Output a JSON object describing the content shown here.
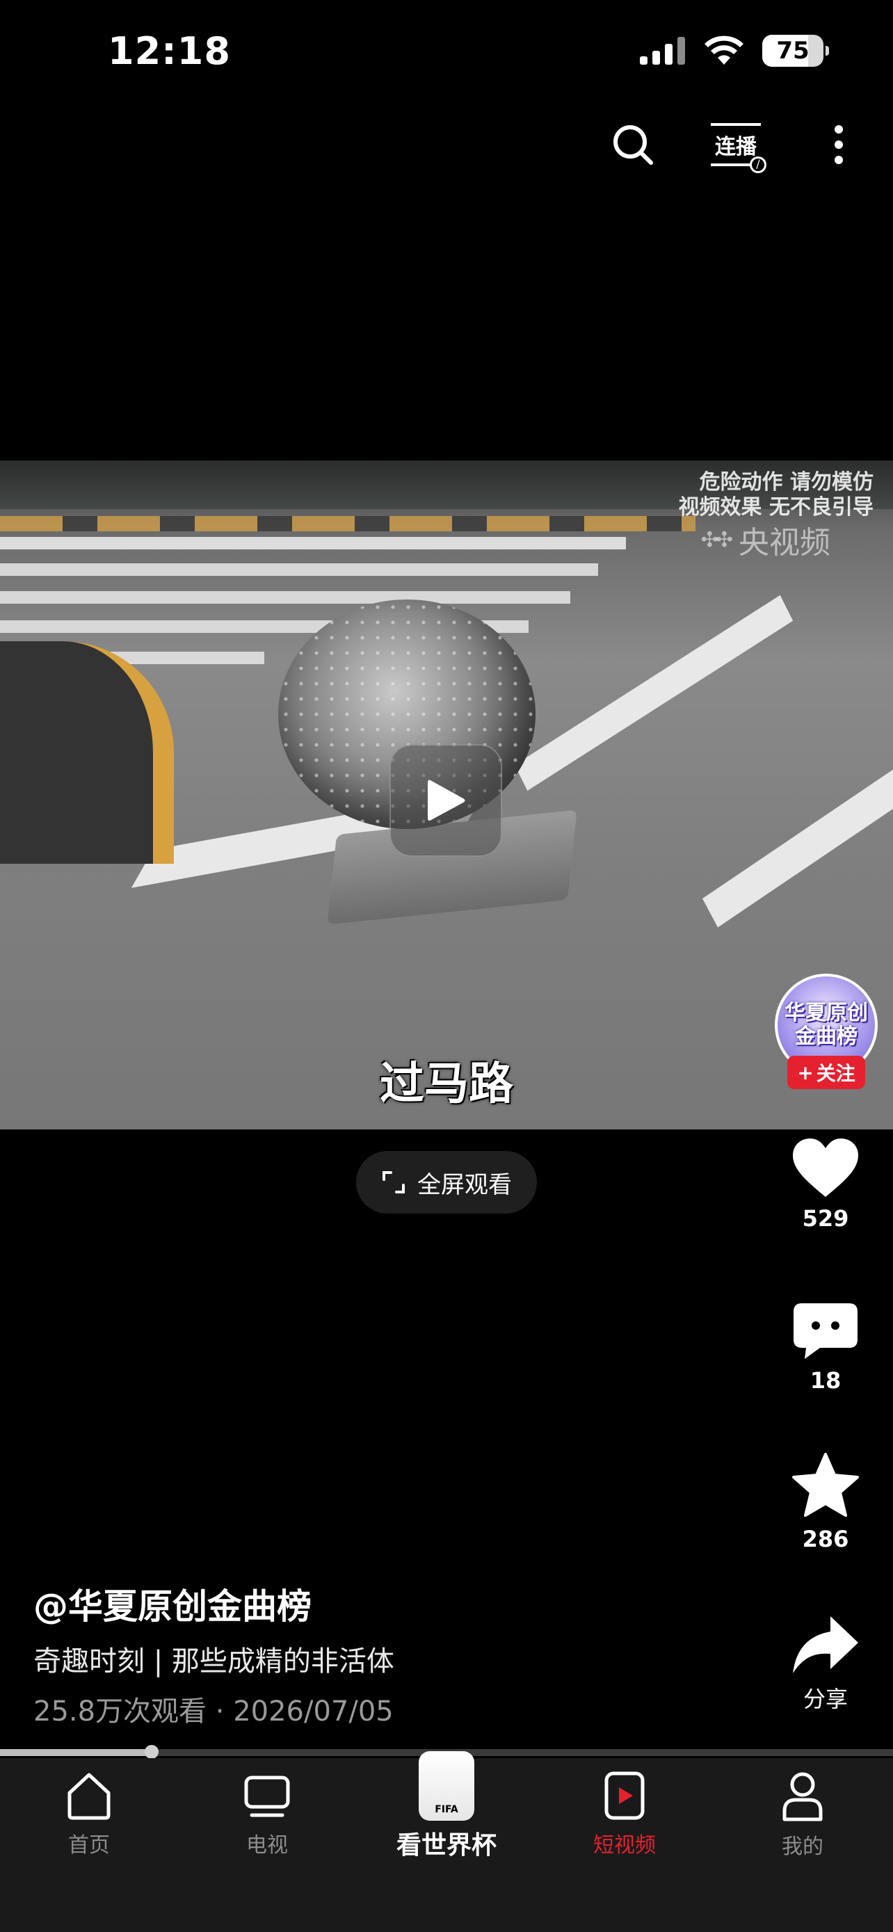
{
  "status_bar": {
    "time": "12:18",
    "battery": "75",
    "battery_level": 0.75
  },
  "top_bar": {
    "search_icon": "search-icon",
    "cast_label": "连播",
    "more_icon": "more-vertical-icon"
  },
  "video": {
    "watermark_line1": "危险动作 请勿模仿",
    "watermark_line2": "视频效果 无不良引导",
    "brand_watermark": "央视频",
    "caption": "过马路",
    "play_icon": "play-icon"
  },
  "fullscreen_label": "全屏观看",
  "author_avatar": {
    "text_line1": "华夏原创",
    "text_line2": "金曲榜",
    "follow_label": "关注"
  },
  "actions": {
    "like_count": "529",
    "comment_count": "18",
    "favorite_count": "286",
    "share_label": "分享"
  },
  "post": {
    "author": "@华夏原创金曲榜",
    "description": "奇趣时刻 | 那些成精的非活体",
    "meta": "25.8万次观看 · 2026/07/05"
  },
  "progress": 0.17,
  "tabs": [
    {
      "label": "首页",
      "icon": "home-icon"
    },
    {
      "label": "电视",
      "icon": "tv-icon"
    },
    {
      "label": "看世界杯",
      "icon": "world-cup-trophy-icon",
      "trophy_text": "FIFA"
    },
    {
      "label": "短视频",
      "icon": "short-video-icon"
    },
    {
      "label": "我的",
      "icon": "profile-icon"
    }
  ],
  "colors": {
    "accent": "#e5212f",
    "tab_inactive": "#8c8c8c",
    "background": "#000000"
  }
}
